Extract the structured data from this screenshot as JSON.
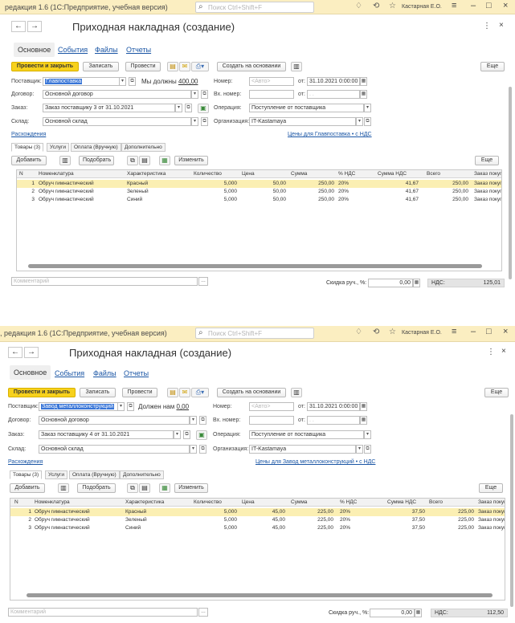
{
  "screens": [
    {
      "app_title": "редакция 1.6  (1С:Предприятие, учебная версия)",
      "search_placeholder": "Поиск Ctrl+Shift+F",
      "user": "Кастарная Е.О.",
      "form_title": "Приходная накладная (создание)",
      "tabs": {
        "main": "Основное",
        "events": "События",
        "files": "Файлы",
        "reports": "Отчеты"
      },
      "toolbar": {
        "post_close": "Провести и закрыть",
        "save": "Записать",
        "post": "Провести",
        "create_based": "Создать на основании",
        "more": "Еще"
      },
      "fields": {
        "supplier_label": "Поставщик:",
        "supplier": "Главпоставка",
        "debt_text": "Мы должны",
        "debt_amount": "400,00",
        "number_label": "Номер:",
        "number": "<Авто>",
        "date_from": "от:",
        "date": "31.10.2021  0:00:00",
        "contract_label": "Договор:",
        "contract": "Основной договор",
        "in_number_label": "Вх. номер:",
        "in_number": "",
        "in_date_from": "от:",
        "in_date": "  .  .",
        "order_label": "Заказ:",
        "order": "Заказ поставщику 3 от 31.10.2021",
        "operation_label": "Операция:",
        "operation": "Поступление от поставщика",
        "warehouse_label": "Склад:",
        "warehouse": "Основной склад",
        "org_label": "Организация:",
        "org": "IT-Kastamaya",
        "discrepancies": "Расхождения",
        "prices_link": "Цены для Главпоставка • с НДС"
      },
      "subtabs": [
        "Товары (3)",
        "Услуги",
        "Оплата (Вручную)",
        "Дополнительно"
      ],
      "table_toolbar": {
        "add": "Добавить",
        "pick": "Подобрать",
        "change": "Изменить",
        "more": "Еще"
      },
      "columns": [
        "N",
        "Номенклатура",
        "Характеристика",
        "Количество",
        "Цена",
        "Сумма",
        "% НДС",
        "Сумма НДС",
        "Всего",
        "Заказ покуп"
      ],
      "rows": [
        [
          "1",
          "Обруч гимнастический",
          "Красный",
          "5,000",
          "50,00",
          "250,00",
          "20%",
          "41,67",
          "250,00",
          "Заказ покуп"
        ],
        [
          "2",
          "Обруч гимнастический",
          "Зеленый",
          "5,000",
          "50,00",
          "250,00",
          "20%",
          "41,67",
          "250,00",
          "Заказ покуп"
        ],
        [
          "3",
          "Обруч гимнастический",
          "Синий",
          "5,000",
          "50,00",
          "250,00",
          "20%",
          "41,67",
          "250,00",
          "Заказ покуп"
        ]
      ],
      "footer": {
        "comment_placeholder": "Комментарий",
        "discount_label": "Скидка руч., %:",
        "discount": "0,00",
        "vat_label": "НДС:",
        "vat": "125,01"
      }
    },
    {
      "app_title": ", редакция 1.6  (1С:Предприятие, учебная версия)",
      "search_placeholder": "Поиск Ctrl+Shift+F",
      "user": "Кастарная Е.О.",
      "form_title": "Приходная накладная (создание)",
      "tabs": {
        "main": "Основное",
        "events": "События",
        "files": "Файлы",
        "reports": "Отчеты"
      },
      "toolbar": {
        "post_close": "Провести и закрыть",
        "save": "Записать",
        "post": "Провести",
        "create_based": "Создать на основании",
        "more": "Еще"
      },
      "fields": {
        "supplier_label": "Поставщик:",
        "supplier": "Завод металлоконструкций",
        "debt_text": "Должен нам",
        "debt_amount": "0,00",
        "number_label": "Номер:",
        "number": "<Авто>",
        "date_from": "от:",
        "date": "31.10.2021  0:00:00",
        "contract_label": "Договор:",
        "contract": "Основной договор",
        "in_number_label": "Вх. номер:",
        "in_number": "",
        "in_date_from": "от:",
        "in_date": "  .  .",
        "order_label": "Заказ:",
        "order": "Заказ поставщику 4 от 31.10.2021",
        "operation_label": "Операция:",
        "operation": "Поступление от поставщика",
        "warehouse_label": "Склад:",
        "warehouse": "Основной склад",
        "org_label": "Организация:",
        "org": "IT-Kastamaya",
        "discrepancies": "Расхождения",
        "prices_link": "Цены для Завод металлоконструкций • с НДС"
      },
      "subtabs": [
        "Товары (3)",
        "Услуги",
        "Оплата (Вручную)",
        "Дополнительно"
      ],
      "table_toolbar": {
        "add": "Добавить",
        "pick": "Подобрать",
        "change": "Изменить",
        "more": "Еще"
      },
      "columns": [
        "N",
        "Номенклатура",
        "Характеристика",
        "Количество",
        "Цена",
        "Сумма",
        "% НДС",
        "Сумма НДС",
        "Всего",
        "Заказ покуп"
      ],
      "rows": [
        [
          "1",
          "Обруч гимнастический",
          "Красный",
          "5,000",
          "45,00",
          "225,00",
          "20%",
          "37,50",
          "225,00",
          "Заказ покуп"
        ],
        [
          "2",
          "Обруч гимнастический",
          "Зеленый",
          "5,000",
          "45,00",
          "225,00",
          "20%",
          "37,50",
          "225,00",
          "Заказ покуп"
        ],
        [
          "3",
          "Обруч гимнастический",
          "Синий",
          "5,000",
          "45,00",
          "225,00",
          "20%",
          "37,50",
          "225,00",
          "Заказ покуп"
        ]
      ],
      "footer": {
        "comment_placeholder": "Комментарий",
        "discount_label": "Скидка руч., %:",
        "discount": "0,00",
        "vat_label": "НДС:",
        "vat": "112,50"
      }
    }
  ],
  "icons": {
    "search": "⌕",
    "bell": "♢",
    "history": "⟲",
    "star": "☆",
    "menu": "≡",
    "minimize": "–",
    "maximize": "□",
    "close": "×",
    "back": "←",
    "forward": "→",
    "kebab": "⋮",
    "dropdown": "▾",
    "open": "⧉",
    "calendar": "▦"
  },
  "colors": {
    "accent": "#f7d11c",
    "titlebar": "#fbeec1",
    "selection": "#fbefb3",
    "link": "#1b56a5"
  }
}
